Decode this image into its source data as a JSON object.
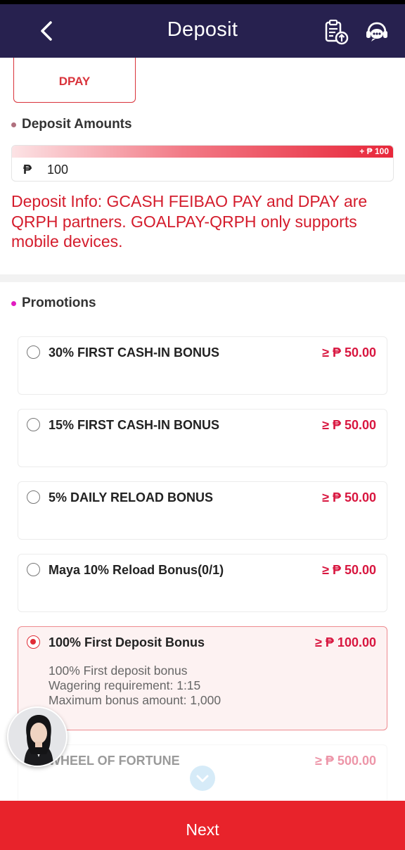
{
  "header": {
    "title": "Deposit",
    "back_icon": "chevron-left-icon",
    "history_icon": "deposit-record-icon",
    "support_icon": "customer-service-icon",
    "background": "#27214f"
  },
  "channel": {
    "selected_label": "DPAY",
    "accent": "#d9333b"
  },
  "deposit_amounts": {
    "title": "Deposit Amounts",
    "bonus_tag": "+ ₱ 100",
    "currency_symbol": "₱",
    "value": "100"
  },
  "info_text": "Deposit Info: GCASH FEIBAO PAY and DPAY are QRPH partners. GOALPAY-QRPH only supports mobile devices.",
  "promotions": {
    "title": "Promotions",
    "items": [
      {
        "name": "30% FIRST CASH-IN BONUS",
        "min": "≥ ₱ 50.00",
        "selected": false
      },
      {
        "name": "15% FIRST CASH-IN BONUS",
        "min": "≥ ₱ 50.00",
        "selected": false
      },
      {
        "name": "5% DAILY RELOAD BONUS",
        "min": "≥ ₱ 50.00",
        "selected": false
      },
      {
        "name": "Maya 10% Reload Bonus(0/1)",
        "min": "≥ ₱ 50.00",
        "selected": false
      },
      {
        "name": "100% First Deposit Bonus",
        "min": "≥ ₱ 100.00",
        "selected": true,
        "desc": [
          "100% First deposit bonus",
          "Wagering requirement: 1:15",
          "Maximum bonus amount: 1,000"
        ]
      },
      {
        "name": "WHEEL OF FORTUNE",
        "min": "≥ ₱ 500.00",
        "selected": false
      }
    ]
  },
  "next_label": "Next",
  "colors": {
    "primary_red": "#e8232b",
    "price_red": "#d8163f",
    "info_red": "#d41c2c"
  }
}
